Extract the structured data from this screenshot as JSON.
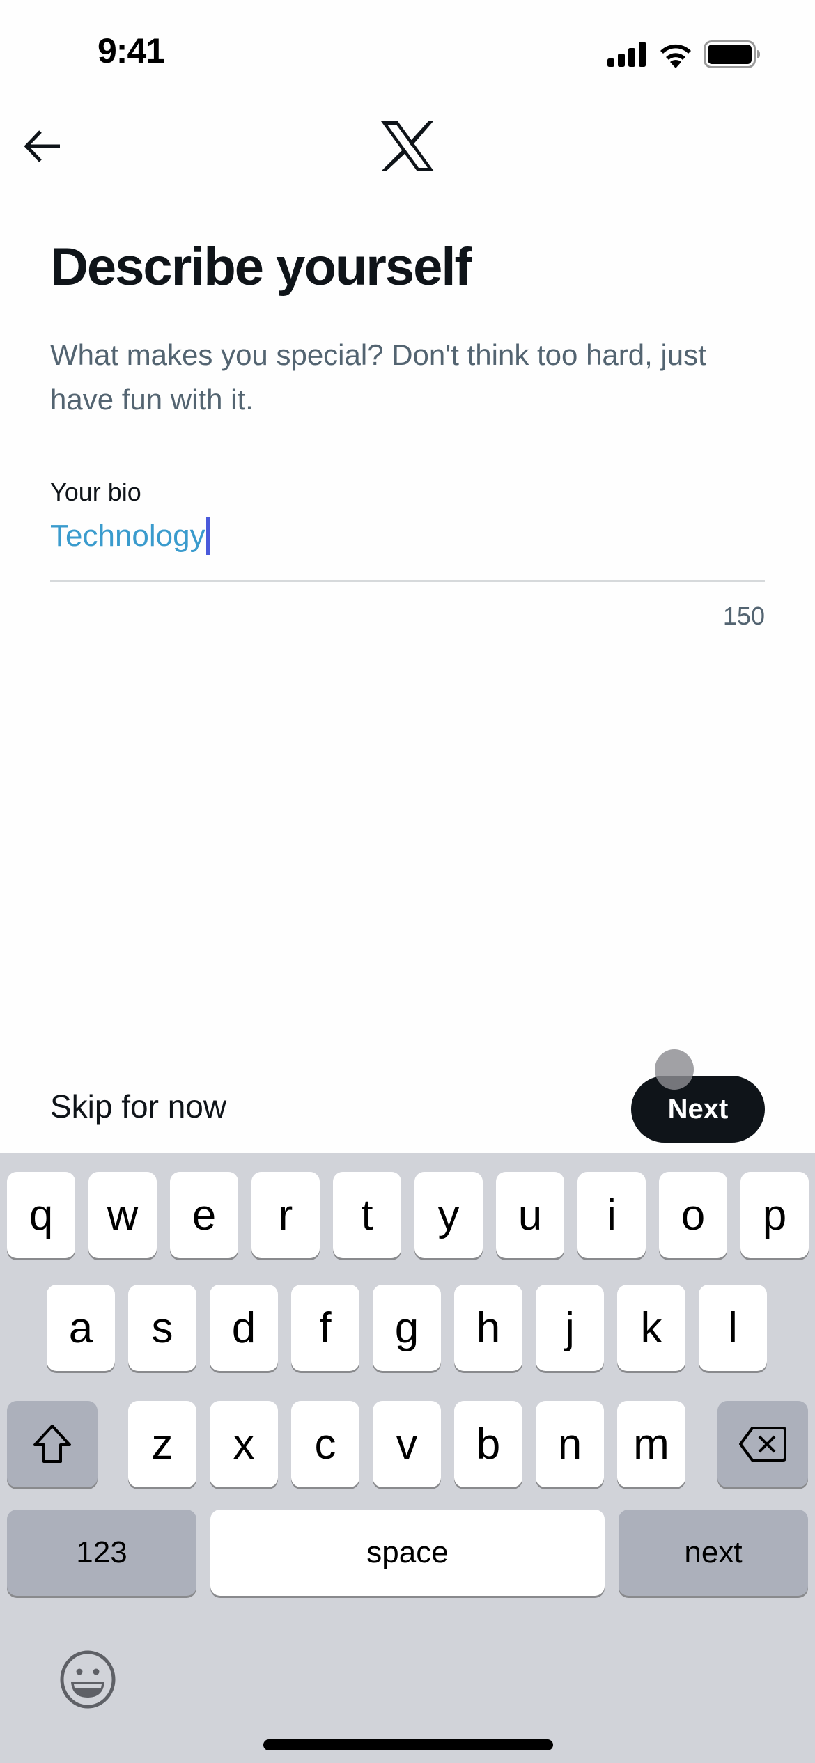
{
  "status_bar": {
    "time": "9:41",
    "icons": [
      "cellular-signal-icon",
      "wifi-icon",
      "battery-icon"
    ]
  },
  "nav": {
    "back_icon": "arrow-left-icon",
    "logo": "x-logo-icon"
  },
  "page": {
    "title": "Describe yourself",
    "subtitle": "What makes you special? Don't think too hard, just have fun with it."
  },
  "bio_field": {
    "label": "Your bio",
    "value": "Technology",
    "char_remaining": "150"
  },
  "actions": {
    "skip_label": "Skip for now",
    "next_label": "Next"
  },
  "colors": {
    "accent_text": "#3a9bcd",
    "caret": "#4a5adb",
    "primary_button": "#0f1419",
    "secondary_text": "#536471"
  },
  "keyboard": {
    "row1": [
      "q",
      "w",
      "e",
      "r",
      "t",
      "y",
      "u",
      "i",
      "o",
      "p"
    ],
    "row2": [
      "a",
      "s",
      "d",
      "f",
      "g",
      "h",
      "j",
      "k",
      "l"
    ],
    "row3": [
      "z",
      "x",
      "c",
      "v",
      "b",
      "n",
      "m"
    ],
    "numbers_label": "123",
    "space_label": "space",
    "return_label": "next",
    "shift_icon": "shift-arrow-icon",
    "delete_icon": "backspace-icon",
    "emoji_icon": "emoji-smiley-icon"
  }
}
